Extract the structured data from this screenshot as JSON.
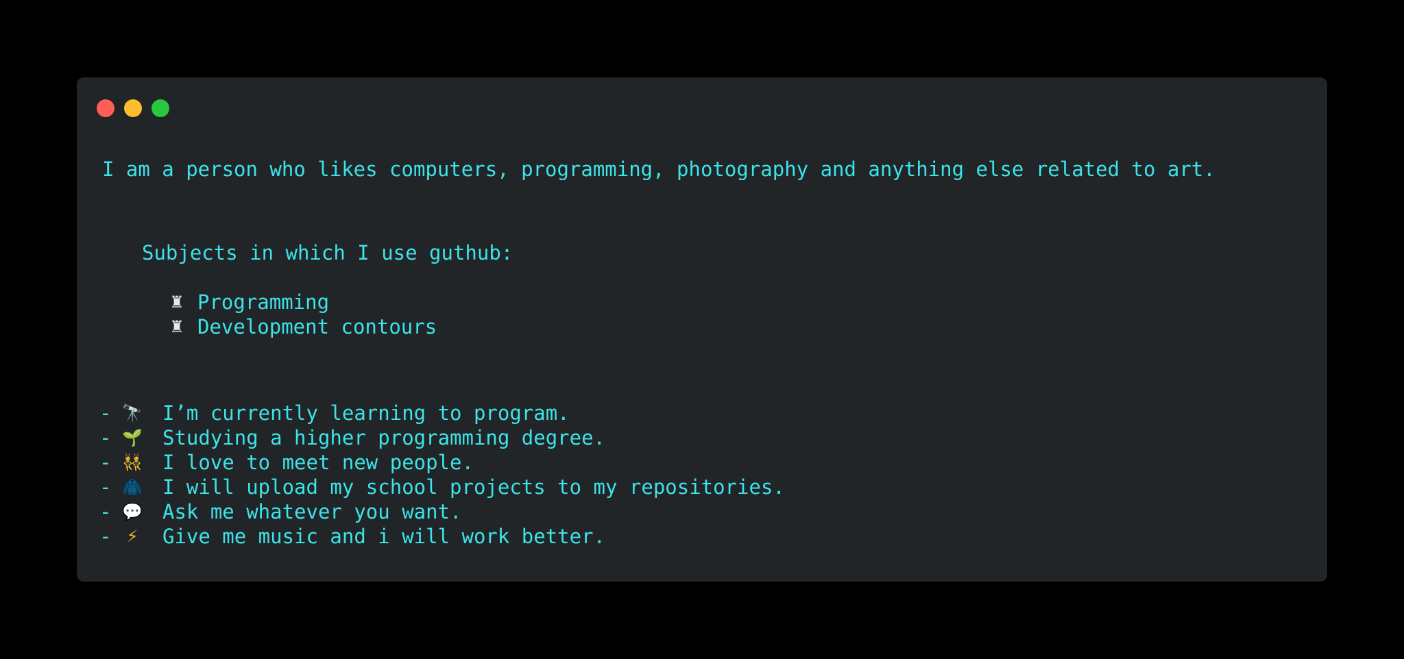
{
  "window": {
    "controls": [
      "close",
      "minimize",
      "maximize"
    ]
  },
  "intro": "I am a person who likes computers, programming, photography and anything else related to art.",
  "subjects": {
    "heading": "Subjects in which I use guthub:",
    "items": [
      {
        "icon": "rook-icon",
        "glyph": "♜",
        "label": "Programming"
      },
      {
        "icon": "rook-icon",
        "glyph": "♜",
        "label": "Development contours"
      }
    ]
  },
  "facts": [
    {
      "dash": "-",
      "icon": "telescope-icon",
      "glyph": "🔭",
      "text": "I’m currently learning to program."
    },
    {
      "dash": "-",
      "icon": "seedling-icon",
      "glyph": "🌱",
      "text": "Studying a higher programming degree."
    },
    {
      "dash": "-",
      "icon": "people-icon",
      "glyph": "👯",
      "text": "I love to meet new people."
    },
    {
      "dash": "-",
      "icon": "jacket-icon",
      "glyph": "🧥",
      "text": "I will upload my school projects to my repositories."
    },
    {
      "dash": "-",
      "icon": "speech-bubble-icon",
      "glyph": "💬",
      "text": "Ask me whatever you want."
    },
    {
      "dash": "-",
      "icon": "lightning-icon",
      "glyph": "⚡",
      "text": "Give me music and i will work better."
    }
  ],
  "colors": {
    "background": "#000000",
    "window": "#212527",
    "text": "#3ce3e8",
    "close": "#ff5f57",
    "minimize": "#febc2e",
    "maximize": "#28c840"
  }
}
